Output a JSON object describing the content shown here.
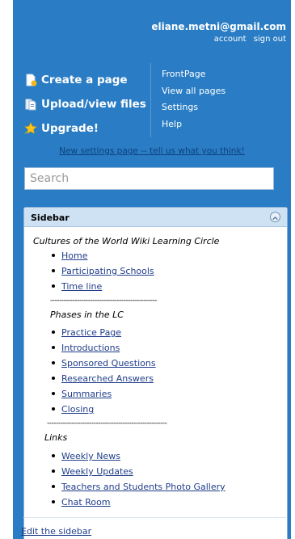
{
  "user": {
    "email": "eliane.metni@gmail.com",
    "account": "account",
    "signout": "sign out"
  },
  "actions": [
    {
      "label": "Create a page",
      "icon": "create-page-icon"
    },
    {
      "label": "Upload/view files",
      "icon": "upload-files-icon"
    },
    {
      "label": "Upgrade!",
      "icon": "star-icon"
    }
  ],
  "links": [
    "FrontPage",
    "View all pages",
    "Settings",
    "Help"
  ],
  "new_settings": "New settings page -- tell us what you think!",
  "search": {
    "placeholder": "Search"
  },
  "sidebar": {
    "title": "Sidebar",
    "heading1": "Cultures of the World  Wiki Learning Circle",
    "group1": [
      "Home",
      "Participating Schools",
      "Time line "
    ],
    "rule1": "------------------------------------------------",
    "heading2": "Phases in the LC",
    "group2": [
      "Practice Page",
      "Introductions",
      "Sponsored Questions",
      "Researched Answers",
      "Summaries",
      "Closing"
    ],
    "rule2": "------------------------------------------------------",
    "heading3": "Links",
    "group3": [
      "Weekly News",
      "Weekly Updates",
      "Teachers and Students Photo Gallery",
      "Chat Room"
    ],
    "edit": "Edit the sidebar"
  },
  "colors": {
    "panel": "#2a7dc4",
    "sidebar_header": "#cfe2f3",
    "link": "#1f3d8a"
  }
}
